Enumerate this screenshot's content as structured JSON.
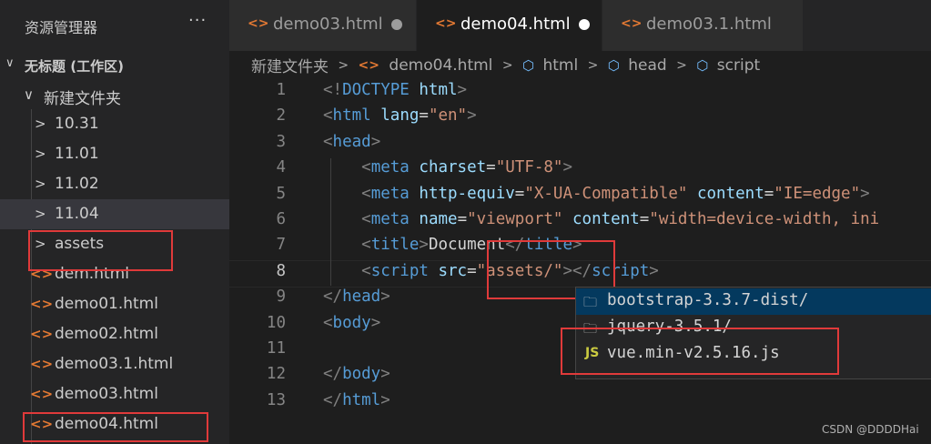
{
  "sidebar": {
    "title": "资源管理器",
    "more": "···",
    "workspace": "无标题 (工作区)",
    "folder": "新建文件夹",
    "items": [
      {
        "label": "10.31",
        "kind": "folder"
      },
      {
        "label": "11.01",
        "kind": "folder"
      },
      {
        "label": "11.02",
        "kind": "folder"
      },
      {
        "label": "11.04",
        "kind": "folder"
      },
      {
        "label": "assets",
        "kind": "folder"
      },
      {
        "label": "dem.html",
        "kind": "file"
      },
      {
        "label": "demo01.html",
        "kind": "file"
      },
      {
        "label": "demo02.html",
        "kind": "file"
      },
      {
        "label": "demo03.1.html",
        "kind": "file"
      },
      {
        "label": "demo03.html",
        "kind": "file"
      },
      {
        "label": "demo04.html",
        "kind": "file"
      }
    ],
    "file_icon": "<>",
    "folder_icon": "chevron-right-icon"
  },
  "tabs": [
    {
      "label": "demo03.html",
      "modified": true,
      "active": false
    },
    {
      "label": "demo04.html",
      "modified": true,
      "active": true
    },
    {
      "label": "demo03.1.html",
      "modified": false,
      "active": false
    }
  ],
  "breadcrumb": [
    "新建文件夹",
    "demo04.html",
    "html",
    "head",
    "script"
  ],
  "editor": {
    "line_numbers": [
      "1",
      "2",
      "3",
      "4",
      "5",
      "6",
      "7",
      "8",
      "9",
      "10",
      "11",
      "12",
      "13"
    ],
    "current_line": "8",
    "lines": [
      {
        "tokens": [
          [
            "tg",
            "<!"
          ],
          [
            "tn",
            "DOCTYPE"
          ],
          [
            "tx",
            " "
          ],
          [
            "at",
            "html"
          ],
          [
            "tg",
            ">"
          ]
        ]
      },
      {
        "tokens": [
          [
            "tg",
            "<"
          ],
          [
            "tn",
            "html"
          ],
          [
            "tx",
            " "
          ],
          [
            "at",
            "lang"
          ],
          [
            "tx",
            "="
          ],
          [
            "st",
            "\"en\""
          ],
          [
            "tg",
            ">"
          ]
        ]
      },
      {
        "tokens": [
          [
            "tg",
            "<"
          ],
          [
            "tn",
            "head"
          ],
          [
            "tg",
            ">"
          ]
        ]
      },
      {
        "tokens": [
          [
            "tx",
            "    "
          ],
          [
            "tg",
            "<"
          ],
          [
            "tn",
            "meta"
          ],
          [
            "tx",
            " "
          ],
          [
            "at",
            "charset"
          ],
          [
            "tx",
            "="
          ],
          [
            "st",
            "\"UTF-8\""
          ],
          [
            "tg",
            ">"
          ]
        ]
      },
      {
        "tokens": [
          [
            "tx",
            "    "
          ],
          [
            "tg",
            "<"
          ],
          [
            "tn",
            "meta"
          ],
          [
            "tx",
            " "
          ],
          [
            "at",
            "http-equiv"
          ],
          [
            "tx",
            "="
          ],
          [
            "st",
            "\"X-UA-Compatible\""
          ],
          [
            "tx",
            " "
          ],
          [
            "at",
            "content"
          ],
          [
            "tx",
            "="
          ],
          [
            "st",
            "\"IE=edge\""
          ],
          [
            "tg",
            ">"
          ]
        ]
      },
      {
        "tokens": [
          [
            "tx",
            "    "
          ],
          [
            "tg",
            "<"
          ],
          [
            "tn",
            "meta"
          ],
          [
            "tx",
            " "
          ],
          [
            "at",
            "name"
          ],
          [
            "tx",
            "="
          ],
          [
            "st",
            "\"viewport\""
          ],
          [
            "tx",
            " "
          ],
          [
            "at",
            "content"
          ],
          [
            "tx",
            "="
          ],
          [
            "st",
            "\"width=device-width, ini"
          ]
        ]
      },
      {
        "tokens": [
          [
            "tx",
            "    "
          ],
          [
            "tg",
            "<"
          ],
          [
            "tn",
            "title"
          ],
          [
            "tg",
            ">"
          ],
          [
            "tx",
            "Document"
          ],
          [
            "tg",
            "</"
          ],
          [
            "tn",
            "title"
          ],
          [
            "tg",
            ">"
          ]
        ]
      },
      {
        "tokens": [
          [
            "tx",
            "    "
          ],
          [
            "tg",
            "<"
          ],
          [
            "tn",
            "script"
          ],
          [
            "tx",
            " "
          ],
          [
            "at",
            "src"
          ],
          [
            "tx",
            "="
          ],
          [
            "st",
            "\"assets/\""
          ],
          [
            "tg",
            "></"
          ],
          [
            "tn",
            "script"
          ],
          [
            "tg",
            ">"
          ]
        ]
      },
      {
        "tokens": [
          [
            "tg",
            "</"
          ],
          [
            "tn",
            "head"
          ],
          [
            "tg",
            ">"
          ]
        ]
      },
      {
        "tokens": [
          [
            "tg",
            "<"
          ],
          [
            "tn",
            "body"
          ],
          [
            "tg",
            ">"
          ]
        ]
      },
      {
        "tokens": []
      },
      {
        "tokens": [
          [
            "tg",
            "</"
          ],
          [
            "tn",
            "body"
          ],
          [
            "tg",
            ">"
          ]
        ]
      },
      {
        "tokens": [
          [
            "tg",
            "</"
          ],
          [
            "tn",
            "html"
          ],
          [
            "tg",
            ">"
          ]
        ]
      }
    ]
  },
  "suggest": {
    "items": [
      {
        "label": "bootstrap-3.3.7-dist/",
        "icon": "folder-icon",
        "selected": true
      },
      {
        "label": "jquery-3.5.1/",
        "icon": "folder-icon",
        "selected": false
      },
      {
        "label": "vue.min-v2.5.16.js",
        "icon": "js-file-icon",
        "selected": false
      }
    ],
    "js_badge": "JS"
  },
  "watermark": "CSDN @DDDDHai",
  "colors": {
    "highlight": "#e03a3a",
    "accent": "#569cd6",
    "html_icon": "#e37933"
  }
}
